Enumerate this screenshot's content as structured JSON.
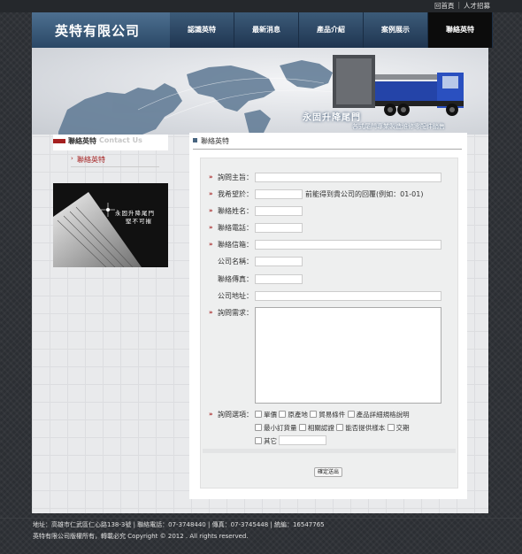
{
  "util_links": {
    "home": "回首頁",
    "jobs": "人才招募"
  },
  "header": {
    "logo": "英特有限公司",
    "nav": [
      "認識英特",
      "最新消息",
      "產品介紹",
      "案例展示",
      "聯絡英特"
    ],
    "active_nav": "聯絡英特"
  },
  "banner": {
    "title": "永固升降尾門",
    "subtitle": "各式尾門專業製造維修零配件銷售"
  },
  "sidebar": {
    "title": "聯絡英特",
    "title_en": "Contact Us",
    "items": [
      {
        "label": "聯絡英特"
      }
    ],
    "promo_line1": "永固升降尾門",
    "promo_line2": "堅不可摧"
  },
  "content": {
    "heading": "聯絡英特",
    "form": {
      "subject_label": "詢問主旨：",
      "expect_label": "我希望於：",
      "expect_hint": "前能得到貴公司的回覆(例如：01-01)",
      "name_label": "聯絡姓名：",
      "phone_label": "聯絡電話：",
      "email_label": "聯絡信箱：",
      "company_label": "公司名稱：",
      "fax_label": "聯絡傳真：",
      "address_label": "公司地址：",
      "need_label": "詢問需求：",
      "options_label": "詢問選項：",
      "options": [
        "單價",
        "原產地",
        "貿易條件",
        "產品詳細規格說明",
        "最小訂貨量",
        "相關認證",
        "能否提供樣本",
        "交期",
        "其它"
      ],
      "submit": "確定送出"
    }
  },
  "footer": {
    "line1": "地址：高雄市仁武區仁心路138-3號 | 聯絡電話：07-3748440 | 傳真：07-3745448 | 統編：16547765",
    "line2": "英特有限公司版權所有，轉載必究    Copyright © 2012 . All rights reserved."
  },
  "colors": {
    "accent": "#a52020",
    "nav_bg": "#1f3550",
    "active_nav": "#0c0c0c"
  }
}
